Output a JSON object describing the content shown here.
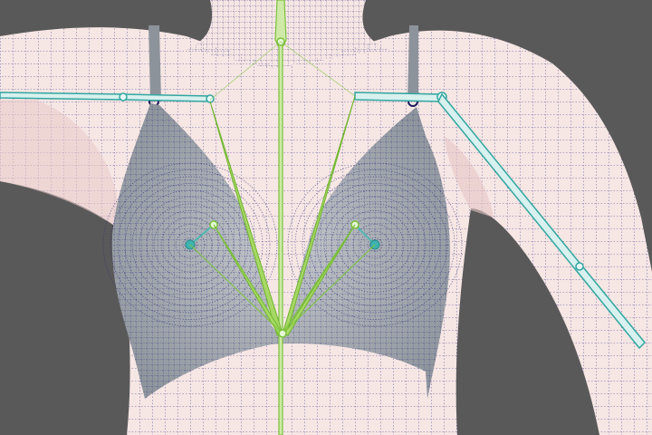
{
  "viewport": {
    "background_color": "#595959",
    "body_mesh_color": "#f6e6e4",
    "garment_mesh_color": "#a9aeb4",
    "wire_color": "#2a2a7a",
    "skeleton_color": "#33a6a0",
    "breast_bone_color": "#7cc23a",
    "spine_bone_color": "#7cc23a"
  },
  "scene": {
    "subject": "female-torso-wireframe",
    "rig": {
      "bones": [
        "left-clavicle-bone",
        "right-clavicle-bone",
        "left-upper-arm-bone",
        "spine-bone",
        "left-breast-bone",
        "right-breast-bone"
      ]
    }
  }
}
